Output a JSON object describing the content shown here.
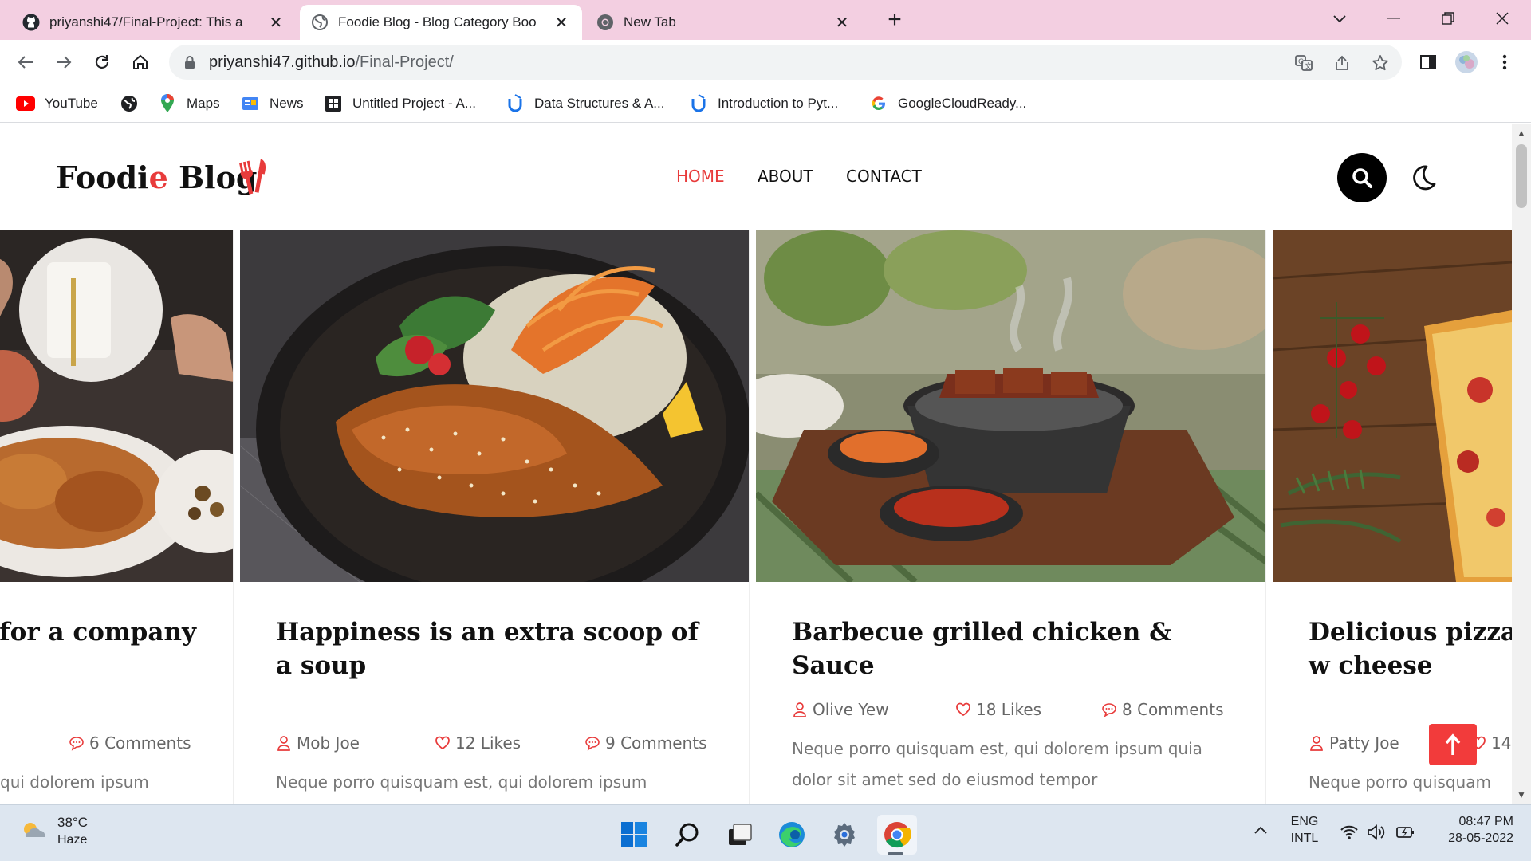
{
  "browser": {
    "tabs": [
      {
        "title": "priyanshi47/Final-Project: This a",
        "favicon": "github-icon",
        "active": false
      },
      {
        "title": "Foodie Blog - Blog Category Boo",
        "favicon": "globe-icon",
        "active": true
      },
      {
        "title": "New Tab",
        "favicon": "chrome-icon",
        "active": false
      }
    ],
    "url_host": "priyanshi47.github.io",
    "url_path": "/Final-Project/",
    "bookmarks": [
      {
        "label": "YouTube",
        "icon": "youtube-icon"
      },
      {
        "label": "",
        "icon": "globe-icon"
      },
      {
        "label": "Maps",
        "icon": "maps-icon"
      },
      {
        "label": "News",
        "icon": "news-icon"
      },
      {
        "label": "Untitled Project - A...",
        "icon": "project-icon"
      },
      {
        "label": "Data Structures & A...",
        "icon": "udemy-icon"
      },
      {
        "label": "Introduction to Pyt...",
        "icon": "udemy-icon"
      },
      {
        "label": "GoogleCloudReady...",
        "icon": "google-icon"
      }
    ]
  },
  "site": {
    "logo_main": "Foodi",
    "logo_accent": "e",
    "logo_rest": " Blog",
    "accent_color": "#e83b3b",
    "nav": [
      {
        "label": "HOME",
        "active": true
      },
      {
        "label": "ABOUT",
        "active": false
      },
      {
        "label": "CONTACT",
        "active": false
      }
    ]
  },
  "posts": [
    {
      "title": "Ideal food for a company",
      "title_visible": "r a company",
      "author": "",
      "likes": "",
      "comments": "6 Comments",
      "excerpt": "qui dolorem ipsum"
    },
    {
      "title": "Happiness is an extra scoop of a soup",
      "author": "Mob Joe",
      "likes": "12 Likes",
      "comments": "9 Comments",
      "excerpt": "Neque porro quisquam est, qui dolorem ipsum"
    },
    {
      "title": "Barbecue grilled chicken & Sauce",
      "author": "Olive Yew",
      "likes": "18 Likes",
      "comments": "8 Comments",
      "excerpt": "Neque porro quisquam est, qui dolorem ipsum quia dolor sit amet sed do eiusmod tempor"
    },
    {
      "title": "Delicious pizza w cheese",
      "author": "Patty Joe",
      "likes": "14",
      "comments": "",
      "excerpt": "Neque porro quisquam"
    }
  ],
  "taskbar": {
    "weather_temp": "38°C",
    "weather_condition": "Haze",
    "lang_top": "ENG",
    "lang_bottom": "INTL",
    "time": "08:47 PM",
    "date": "28-05-2022",
    "apps": [
      "windows-start-icon",
      "search-icon",
      "task-view-icon",
      "edge-icon",
      "settings-icon",
      "chrome-icon"
    ]
  }
}
